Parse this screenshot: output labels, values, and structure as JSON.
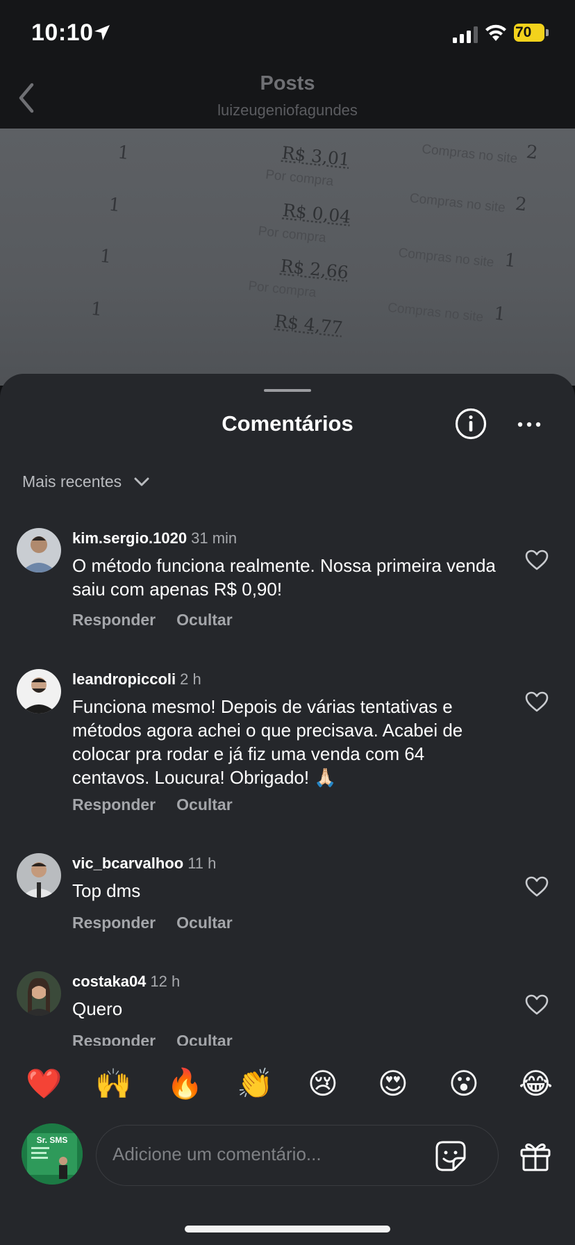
{
  "status": {
    "time": "10:10",
    "battery": "70"
  },
  "nav": {
    "title": "Posts",
    "username": "luizeugeniofagundes"
  },
  "post_photo": {
    "prices": [
      "R$ 3,01",
      "R$ 0,04",
      "R$ 2,66",
      "R$ 4,77"
    ],
    "per_purchase": [
      "Por compra",
      "Por compra",
      "Por compra"
    ],
    "qty_left": [
      "1",
      "1",
      "1",
      "1"
    ],
    "qty_right": [
      "2",
      "2",
      "1",
      "1"
    ],
    "site_label": [
      "Compras no site",
      "Compras no site",
      "Compras no site",
      "Compras no site"
    ]
  },
  "comments_sheet": {
    "title": "Comentários",
    "sort_label": "Mais recentes",
    "reply_label": "Responder",
    "hide_label": "Ocultar",
    "comments": [
      {
        "user": "kim.sergio.1020",
        "time": "31 min",
        "text": "O método funciona realmente. Nossa primeira venda saiu com apenas R$ 0,90!"
      },
      {
        "user": "leandropiccoli",
        "time": "2 h",
        "text": "Funciona mesmo! Depois de várias tentativas e métodos agora achei o que precisava. Acabei de colocar pra rodar e já fiz uma venda com 64 centavos. Loucura! Obrigado! 🙏🏻"
      },
      {
        "user": "vic_bcarvalhoo",
        "time": "11 h",
        "text": "Top dms"
      },
      {
        "user": "costaka04",
        "time": "12 h",
        "text": "Quero"
      }
    ]
  },
  "reactions": [
    "❤️",
    "🙌",
    "🔥",
    "👏",
    "😢",
    "😍",
    "😮",
    "😂"
  ],
  "composer": {
    "placeholder": "Adicione um comentário...",
    "avatar_text": "Sr. SMS"
  }
}
